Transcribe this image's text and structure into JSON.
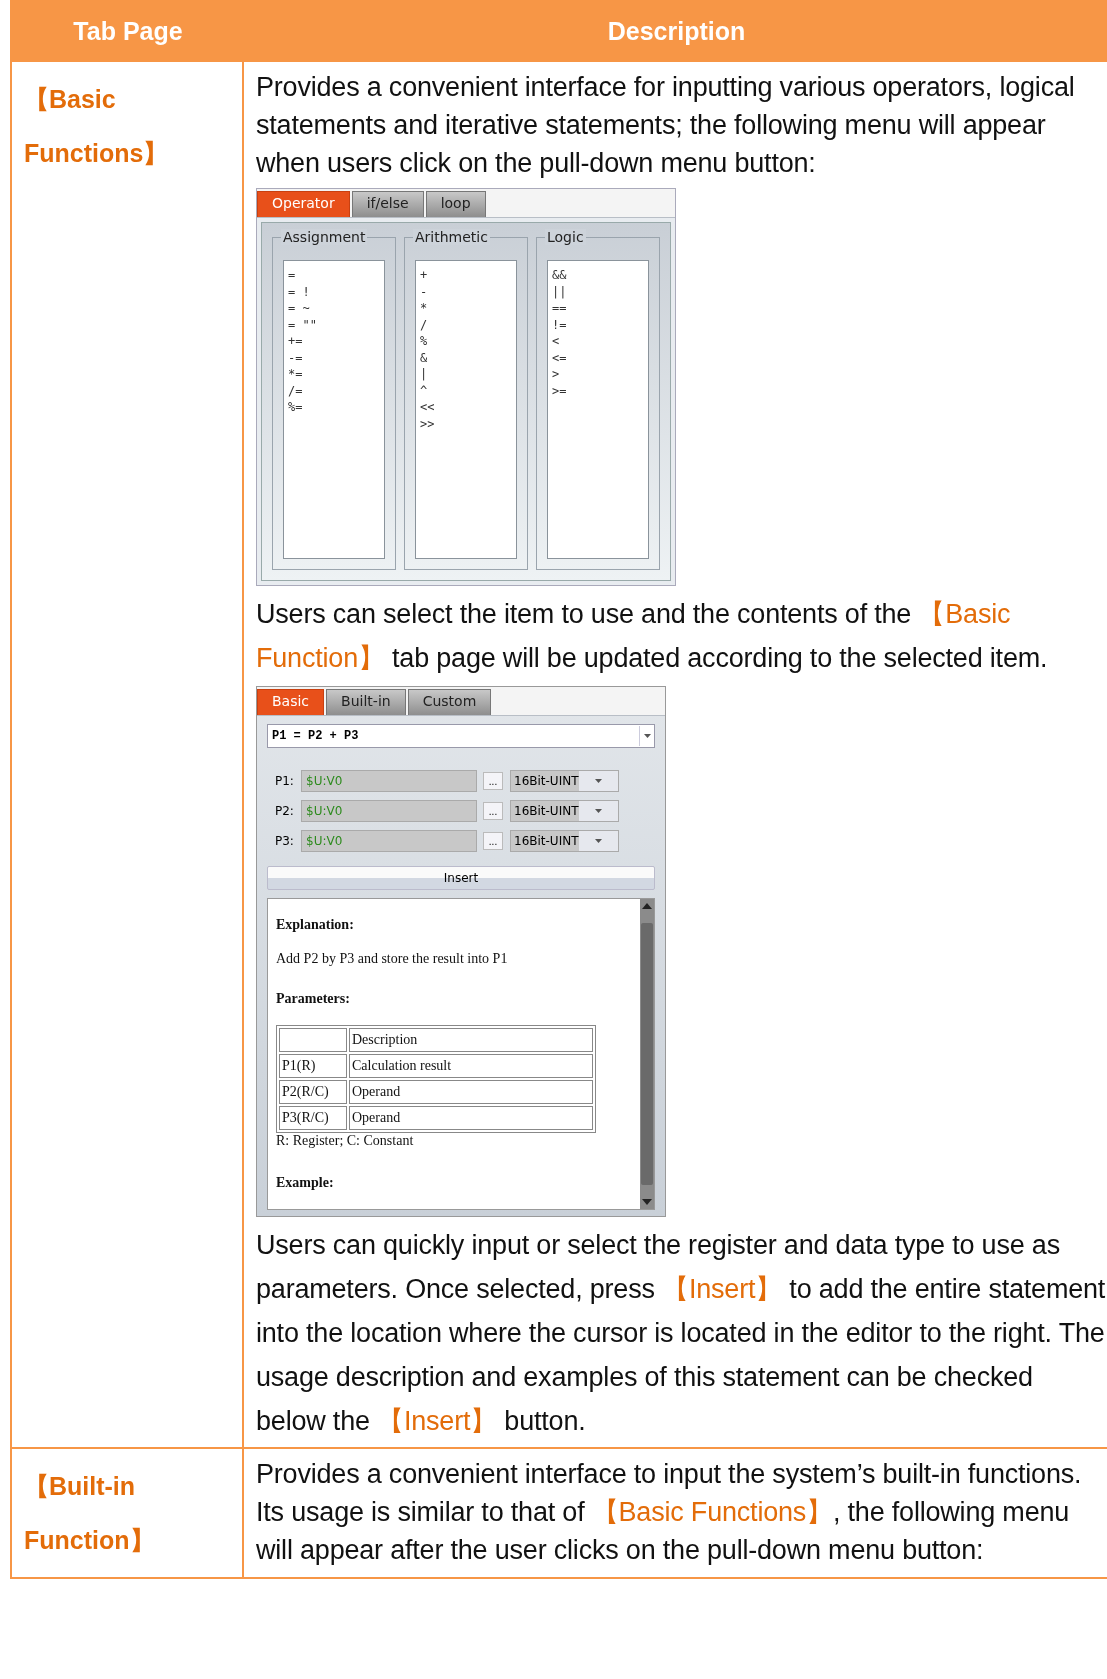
{
  "table": {
    "columns": [
      "Tab Page",
      "Description"
    ],
    "rows": [
      {
        "tab_page": "【Basic Functions】",
        "description": [
          {
            "kind": "paragraph",
            "segments": [
              {
                "kind": "plain",
                "text": "Provides a convenient interface for inputting various operators, logical statements and iterative statements; the following menu will appear when users click on the pull-down menu button:"
              }
            ]
          },
          {
            "kind": "operator_panel",
            "tabs": [
              {
                "label": "Operator",
                "selected": true
              },
              {
                "label": "if/else",
                "selected": false
              },
              {
                "label": "loop",
                "selected": false
              }
            ],
            "groups": [
              {
                "title": "Assignment",
                "items": [
                  "=",
                  "= !",
                  "= ~",
                  "= \"\"",
                  "+=",
                  "-=",
                  "*=",
                  "/=",
                  "%="
                ]
              },
              {
                "title": "Arithmetic",
                "items": [
                  "+",
                  "-",
                  "*",
                  "/",
                  "%",
                  "&",
                  "|",
                  "^",
                  "<<",
                  ">>"
                ]
              },
              {
                "title": "Logic",
                "items": [
                  "&&",
                  "||",
                  "==",
                  "!=",
                  "<",
                  "<=",
                  ">",
                  ">="
                ]
              }
            ]
          },
          {
            "kind": "paragraph",
            "segments": [
              {
                "kind": "plain",
                "text": "Users can select the item to use and the contents of the "
              },
              {
                "kind": "highlight",
                "text": "【Basic Function】"
              },
              {
                "kind": "plain",
                "text": " tab page will be updated according to the selected item."
              }
            ]
          },
          {
            "kind": "function_panel",
            "tabs": [
              {
                "label": "Basic",
                "selected": true
              },
              {
                "label": "Built-in",
                "selected": false
              },
              {
                "label": "Custom",
                "selected": false
              }
            ],
            "statement": "P1 = P2 + P3",
            "params": [
              {
                "label": "P1:",
                "value": "$U:V0",
                "browse": "...",
                "type": "16Bit-UINT"
              },
              {
                "label": "P2:",
                "value": "$U:V0",
                "browse": "...",
                "type": "16Bit-UINT"
              },
              {
                "label": "P3:",
                "value": "$U:V0",
                "browse": "...",
                "type": "16Bit-UINT"
              }
            ],
            "insert_button": "Insert",
            "help": {
              "explanation_heading": "Explanation:",
              "explanation": "Add P2 by P3 and store the result into P1",
              "parameters_heading": "Parameters:",
              "param_table": {
                "header": "Description",
                "rows": [
                  [
                    "P1(R)",
                    "Calculation result"
                  ],
                  [
                    "P2(R/C)",
                    "Operand"
                  ],
                  [
                    "P3(R/C)",
                    "Operand"
                  ]
                ]
              },
              "note": "R: Register; C: Constant",
              "example_heading": "Example:"
            }
          },
          {
            "kind": "paragraph",
            "segments": [
              {
                "kind": "plain",
                "text": "Users can quickly input or select the register and data type to use as parameters. Once selected, press "
              },
              {
                "kind": "highlight",
                "text": "【Insert】"
              },
              {
                "kind": "plain",
                "text": " to add the entire statement into the location where the cursor is located in the editor to the right. The usage description and examples of this statement can be checked below the "
              },
              {
                "kind": "highlight",
                "text": "【Insert】"
              },
              {
                "kind": "plain",
                "text": " button."
              }
            ]
          }
        ]
      },
      {
        "tab_page": "【Built-in Function】",
        "description": [
          {
            "kind": "paragraph",
            "segments": [
              {
                "kind": "plain",
                "text": "Provides a convenient interface to input the system’s built-in functions. Its usage is similar to that of "
              },
              {
                "kind": "highlight",
                "text": "【Basic Functions】"
              },
              {
                "kind": "plain",
                "text": ", the following menu will appear after the user clicks on the pull-down menu button:"
              }
            ]
          }
        ]
      }
    ]
  }
}
